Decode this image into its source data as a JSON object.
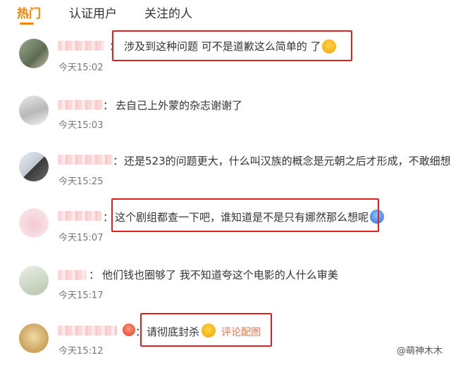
{
  "tabs": [
    {
      "label": "热门",
      "active": true
    },
    {
      "label": "认证用户",
      "active": false
    },
    {
      "label": "关注的人",
      "active": false
    }
  ],
  "comments": [
    {
      "colon": "：",
      "text": "涉及到这种问题 可不是道歉这么简单的 了",
      "time": "今天15:02",
      "emoji": "scared-face"
    },
    {
      "colon": "：",
      "text": "去自己上外蒙的杂志谢谢了",
      "time": "今天15:03"
    },
    {
      "colon": "：",
      "text": "还是523的问题更大，什么叫汉族的概念是元朝之后才形成，不敢细想",
      "time": "今天15:25"
    },
    {
      "colon": "：",
      "text": "这个剧组都查一下吧，谁知道是不是只有娜然那么想呢",
      "time": "今天15:07",
      "emoji": "fearful-face"
    },
    {
      "colon": "：",
      "text": "他们钱也圈够了 我不知道夸这个电影的人什么审美",
      "time": "今天15:17"
    },
    {
      "colon": "：",
      "text": "请彻底封杀",
      "time": "今天15:12",
      "emoji": "scream-face",
      "link": "评论配图"
    }
  ],
  "watermark": "@萌神木木",
  "colors": {
    "accent": "#ff8200",
    "highlight_box": "#e02020",
    "link": "#eb7350"
  }
}
